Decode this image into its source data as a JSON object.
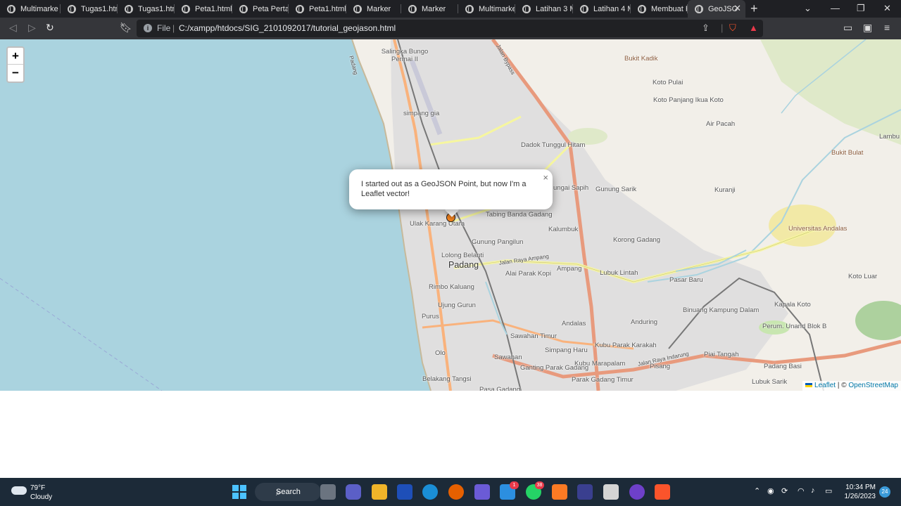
{
  "browser": {
    "tabs": [
      {
        "title": "Multimarke",
        "active": false
      },
      {
        "title": "Tugas1.htm",
        "active": false
      },
      {
        "title": "Tugas1.htm",
        "active": false
      },
      {
        "title": "Peta1.html",
        "active": false
      },
      {
        "title": "Peta Pertan",
        "active": false
      },
      {
        "title": "Peta1.html",
        "active": false
      },
      {
        "title": "Marker",
        "active": false
      },
      {
        "title": "Marker",
        "active": false
      },
      {
        "title": "Multimarke",
        "active": false
      },
      {
        "title": "Latihan 3 M",
        "active": false
      },
      {
        "title": "Latihan 4 M",
        "active": false
      },
      {
        "title": "Membuat P",
        "active": false
      },
      {
        "title": "GeoJSO",
        "active": true
      }
    ],
    "new_tab": "+",
    "address_scheme": "File",
    "address_url": "C:/xampp/htdocs/SIG_2101092017/tutorial_geojason.html"
  },
  "map": {
    "zoom_in": "+",
    "zoom_out": "−",
    "popup_text": "I started out as a GeoJSON Point, but now I'm a Leaflet vector!",
    "popup_close": "×",
    "marker_color": "#ff7800",
    "water_color": "#aad3df",
    "attribution_leaflet": "Leaflet",
    "attribution_sep": "| ©",
    "attribution_osm": "OpenStreetMap",
    "labels": [
      {
        "text": "Salingka Bungo Permai II",
        "style": ""
      },
      {
        "text": "simpang gia",
        "style": ""
      },
      {
        "text": "Bukit Kadik",
        "style": "brown"
      },
      {
        "text": "Koto Pulai",
        "style": ""
      },
      {
        "text": "Koto Panjang Ikua Koto",
        "style": ""
      },
      {
        "text": "Air Pacah",
        "style": ""
      },
      {
        "text": "Lambu",
        "style": ""
      },
      {
        "text": "Bukit Bulat",
        "style": "brown"
      },
      {
        "text": "Dadok Tunggul Hitam",
        "style": ""
      },
      {
        "text": "Gunung Sarik",
        "style": ""
      },
      {
        "text": "Kuranji",
        "style": ""
      },
      {
        "text": "ungai Sapih",
        "style": ""
      },
      {
        "text": "Tabing Banda Gadang",
        "style": ""
      },
      {
        "text": "Kalumbuk",
        "style": ""
      },
      {
        "text": "Ulak Karang Utara",
        "style": ""
      },
      {
        "text": "Gunung Pangilun",
        "style": ""
      },
      {
        "text": "Korong Gadang",
        "style": ""
      },
      {
        "text": "Universitas Andalas",
        "style": "brown"
      },
      {
        "text": "Lolong Belanti",
        "style": ""
      },
      {
        "text": "Padang",
        "style": "big"
      },
      {
        "text": "Ampang",
        "style": ""
      },
      {
        "text": "Lubuk Lintah",
        "style": ""
      },
      {
        "text": "Alai Parak Kopi",
        "style": ""
      },
      {
        "text": "Pasar Baru",
        "style": ""
      },
      {
        "text": "Koto Luar",
        "style": ""
      },
      {
        "text": "Rimbo Kaluang",
        "style": ""
      },
      {
        "text": "Ujung Gurun",
        "style": ""
      },
      {
        "text": "Kapala Koto",
        "style": ""
      },
      {
        "text": "Binuang Kampung Dalam",
        "style": ""
      },
      {
        "text": "Purus",
        "style": ""
      },
      {
        "text": "Andalas",
        "style": ""
      },
      {
        "text": "Anduring",
        "style": ""
      },
      {
        "text": "Perum. Unand Blok B",
        "style": ""
      },
      {
        "text": "Sawahan Timur",
        "style": ""
      },
      {
        "text": "Olo",
        "style": ""
      },
      {
        "text": "Simpang Haru",
        "style": ""
      },
      {
        "text": "Kubu Parak Karakah",
        "style": ""
      },
      {
        "text": "Piai Tangah",
        "style": ""
      },
      {
        "text": "Sawahan",
        "style": ""
      },
      {
        "text": "Kubu Marapalam",
        "style": ""
      },
      {
        "text": "Pisang",
        "style": ""
      },
      {
        "text": "Padang Basi",
        "style": ""
      },
      {
        "text": "Ganting Parak Gadang",
        "style": ""
      },
      {
        "text": "Parak Gadang Timur",
        "style": ""
      },
      {
        "text": "Lubuk Sarik",
        "style": ""
      },
      {
        "text": "Belakang Tangsi",
        "style": ""
      },
      {
        "text": "Pasa Gadang",
        "style": ""
      },
      {
        "text": "Jalan Bypass",
        "style": "road"
      },
      {
        "text": "Jalan Raya Ampang",
        "style": "road"
      },
      {
        "text": "Jalan Raya Indarung",
        "style": "road"
      },
      {
        "text": "Padang",
        "style": "road"
      }
    ]
  },
  "taskbar": {
    "temperature": "79°F",
    "condition": "Cloudy",
    "search_label": "Search",
    "mail_badge": "1",
    "whatsapp_badge": "38",
    "time": "10:34 PM",
    "date": "1/26/2023",
    "notifications": "24"
  }
}
